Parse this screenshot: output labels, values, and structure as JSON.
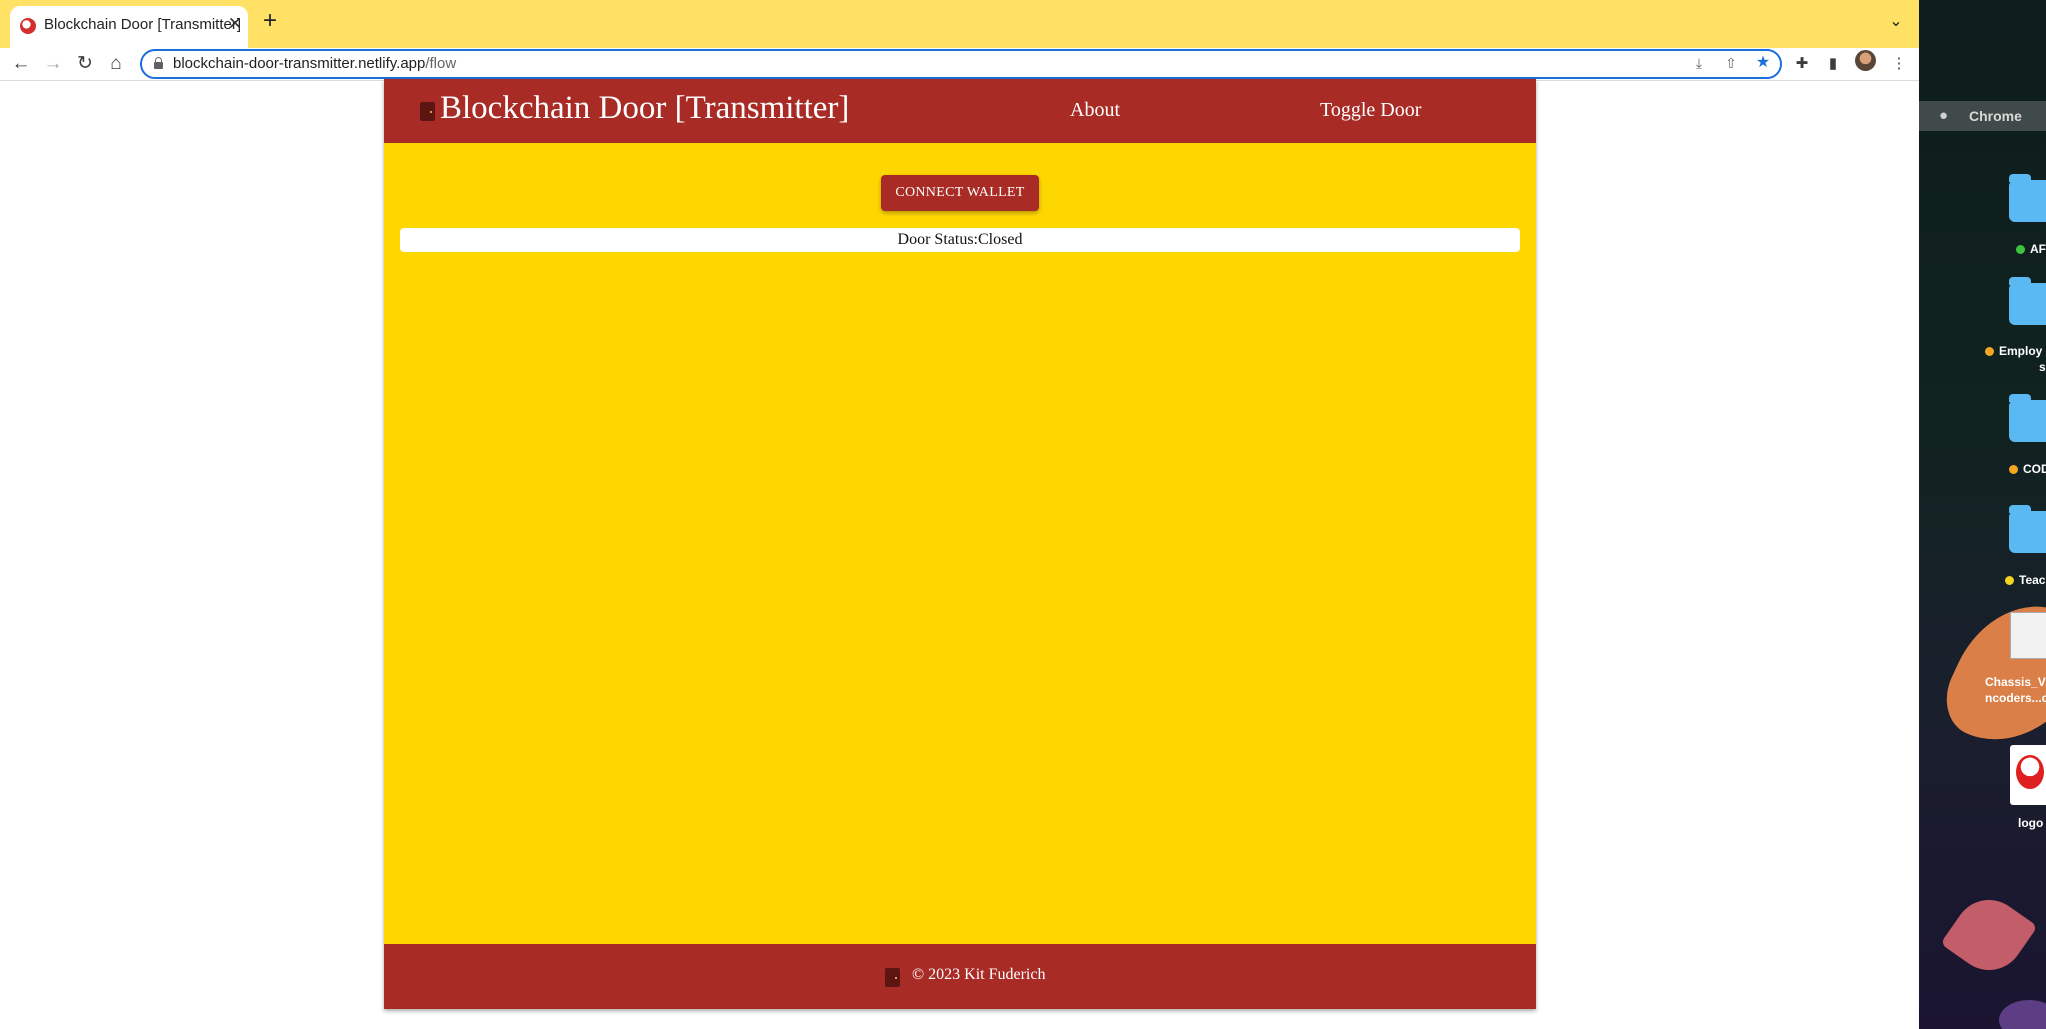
{
  "browser": {
    "tab_title": "Blockchain Door [Transmitter]",
    "url_host": "blockchain-door-transmitter.netlify.app",
    "url_path": "/flow",
    "accent_color": "#1a6fdc",
    "tabstrip_color": "#ffe165"
  },
  "site": {
    "title": "Blockchain Door [Transmitter]",
    "nav": {
      "about": "About",
      "toggle_door": "Toggle Door"
    },
    "connect_button": "CONNECT WALLET",
    "status_label": "Door Status:",
    "status_value": "Closed",
    "footer_text": "© 2023 Kit Fuderich",
    "colors": {
      "primary": "#a82b26",
      "background": "#ffd700"
    }
  },
  "desktop": {
    "menubar_app": "Chrome",
    "items": [
      {
        "label": "AF",
        "dot_color": "#3cc43c"
      },
      {
        "label": "Employ",
        "label2": "s",
        "dot_color": "#f5a623"
      },
      {
        "label": "COD",
        "dot_color": "#f5a623"
      },
      {
        "label": "Teac",
        "dot_color": "#f5d323"
      },
      {
        "label": "Chassis_V",
        "label2": "ncoders...c"
      },
      {
        "label": "logo"
      }
    ]
  }
}
